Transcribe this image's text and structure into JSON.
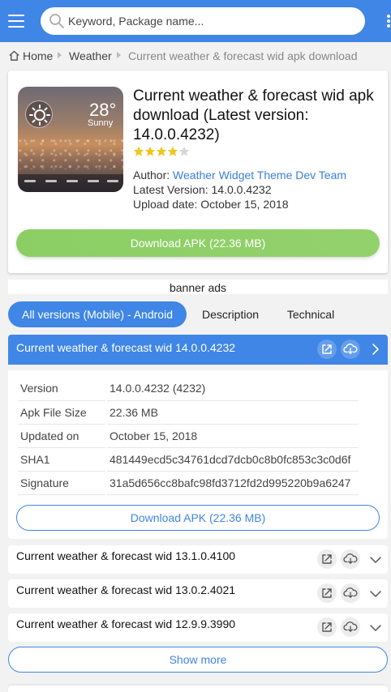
{
  "header": {
    "search_placeholder": "Keyword, Package name...",
    "accent_color": "#3f86e6"
  },
  "breadcrumb": {
    "home": "Home",
    "category": "Weather",
    "current": "Current weather & forecast wid apk download"
  },
  "app": {
    "title": "Current weather & forecast wid apk download (Latest version: 14.0.0.4232)",
    "rating_stars": 4,
    "rating_max": 5,
    "author_label": "Author: ",
    "author": "Weather Widget Theme Dev Team",
    "latest_version_label": "Latest Version: ",
    "latest_version": "14.0.0.4232",
    "upload_label": "Upload date: ",
    "upload_date": "October 15, 2018",
    "download_label": "Download APK (22.36 MB)",
    "icon_temp": "28°",
    "icon_condition": "Sunny"
  },
  "banner": {
    "label": "banner ads"
  },
  "tabs": [
    {
      "label": "All versions (Mobile) - Android",
      "active": true
    },
    {
      "label": "Description",
      "active": false
    },
    {
      "label": "Technical",
      "active": false
    }
  ],
  "versions": {
    "expanded": {
      "title": "Current weather & forecast wid 14.0.0.4232",
      "rows": [
        {
          "key": "Version",
          "value": "14.0.0.4232 (4232)"
        },
        {
          "key": "Apk File Size",
          "value": "22.36 MB"
        },
        {
          "key": "Updated on",
          "value": "October 15, 2018"
        },
        {
          "key": "SHA1",
          "value": "481449ecd5c34761dcd7dcb0c8b0fc853c3c0d6f"
        },
        {
          "key": "Signature",
          "value": "31a5d656cc8bafc98fd3712fd2d995220b9a6247"
        }
      ],
      "download_label": "Download APK (22.36 MB)"
    },
    "collapsed": [
      {
        "title": "Current weather & forecast wid 13.1.0.4100"
      },
      {
        "title": "Current weather & forecast wid 13.0.2.4021"
      },
      {
        "title": "Current weather & forecast wid 12.9.9.3990"
      }
    ],
    "show_more_label": "Show more"
  }
}
